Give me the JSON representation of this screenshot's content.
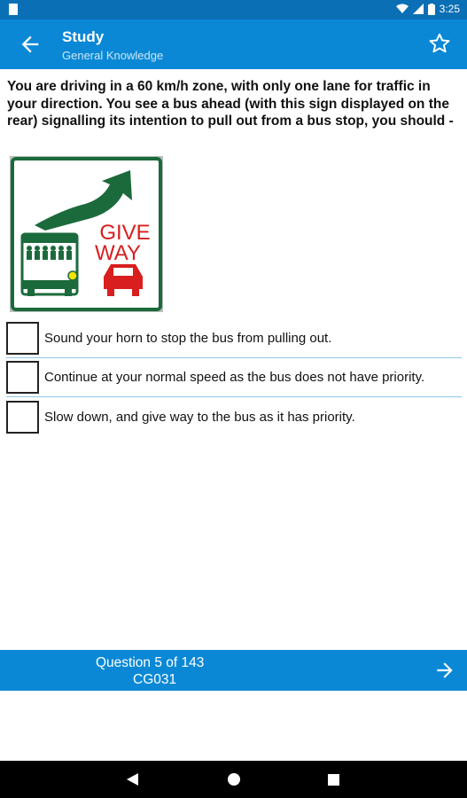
{
  "status_bar": {
    "time": "3:25"
  },
  "app_bar": {
    "title": "Study",
    "subtitle": "General Knowledge"
  },
  "question": {
    "text": "You are driving in a 60 km/h zone, with only one lane for traffic in your direction. You see a bus ahead (with this sign displayed on the rear) signalling its intention to pull out from a bus stop, you should -"
  },
  "sign": {
    "line1": "GIVE",
    "line2": "WAY",
    "colors": {
      "green": "#1b6a3b",
      "red": "#d81e1e"
    }
  },
  "options": [
    {
      "text": "Sound your horn to stop the bus from pulling out."
    },
    {
      "text": "Continue at your normal speed as the bus does not have priority."
    },
    {
      "text": "Slow down, and give way to the bus as it has priority."
    }
  ],
  "footer": {
    "counter": "Question 5 of 143",
    "code": "CG031"
  },
  "colors": {
    "primary": "#0a88d6",
    "status": "#0a6fb5",
    "divider": "#8fc7ea"
  }
}
